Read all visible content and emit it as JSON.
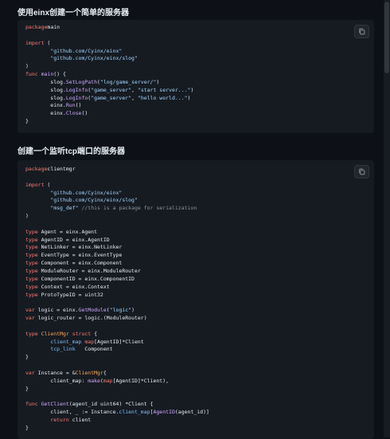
{
  "sections": [
    {
      "heading": "使用einx创建一个简单的服务器",
      "code": [
        [
          [
            "kw",
            "package"
          ],
          [
            "",
            "main"
          ]
        ],
        [],
        [
          [
            "kw",
            "import"
          ],
          [
            "",
            " ("
          ]
        ],
        [
          [
            "",
            " \t"
          ],
          [
            "str",
            "\"github.com/Cyinx/einx\""
          ]
        ],
        [
          [
            "",
            " \t"
          ],
          [
            "str",
            "\"github.com/Cyinx/einx/slog\""
          ]
        ],
        [
          [
            "",
            ")"
          ]
        ],
        [
          [
            "kw",
            "func"
          ],
          [
            "",
            " "
          ],
          [
            "fn",
            "main"
          ],
          [
            "",
            "() {"
          ]
        ],
        [
          [
            "",
            " \tslog."
          ],
          [
            "fn",
            "SetLogPath"
          ],
          [
            "",
            "("
          ],
          [
            "str",
            "\"log/game_server/\""
          ],
          [
            "",
            ")"
          ]
        ],
        [
          [
            "",
            " \tslog."
          ],
          [
            "fn",
            "LogInfo"
          ],
          [
            "",
            "("
          ],
          [
            "str",
            "\"game_server\""
          ],
          [
            "",
            ", "
          ],
          [
            "str",
            "\"start server...\""
          ],
          [
            "",
            ")"
          ]
        ],
        [
          [
            "",
            " \tslog."
          ],
          [
            "fn",
            "LogInfo"
          ],
          [
            "",
            "("
          ],
          [
            "str",
            "\"game_server\""
          ],
          [
            "",
            ", "
          ],
          [
            "str",
            "\"hello world...\""
          ],
          [
            "",
            ")"
          ]
        ],
        [
          [
            "",
            " \teinx."
          ],
          [
            "fn",
            "Run"
          ],
          [
            "",
            "()"
          ]
        ],
        [
          [
            "",
            " \teinx."
          ],
          [
            "fn",
            "Close"
          ],
          [
            "",
            "()"
          ]
        ],
        [
          [
            "",
            "}"
          ]
        ]
      ]
    },
    {
      "heading": "创建一个监听tcp端口的服务器",
      "code": [
        [
          [
            "kw",
            "package"
          ],
          [
            "",
            "clientmgr"
          ]
        ],
        [],
        [
          [
            "kw",
            "import"
          ],
          [
            "",
            " ("
          ]
        ],
        [
          [
            "",
            " \t"
          ],
          [
            "str",
            "\"github.com/Cyinx/einx\""
          ]
        ],
        [
          [
            "",
            " \t"
          ],
          [
            "str",
            "\"github.com/Cyinx/einx/slog\""
          ]
        ],
        [
          [
            "",
            " \t"
          ],
          [
            "str",
            "\"msg_def\""
          ],
          [
            "",
            " "
          ],
          [
            "cm",
            "//this is a package for serialization"
          ]
        ],
        [
          [
            "",
            ")"
          ]
        ],
        [],
        [
          [
            "kw",
            "type"
          ],
          [
            "",
            " Agent = einx.Agent"
          ]
        ],
        [
          [
            "kw",
            "type"
          ],
          [
            "",
            " AgentID = einx.AgentID"
          ]
        ],
        [
          [
            "kw",
            "type"
          ],
          [
            "",
            " NetLinker = einx.NetLinker"
          ]
        ],
        [
          [
            "kw",
            "type"
          ],
          [
            "",
            " EventType = einx.EventType"
          ]
        ],
        [
          [
            "kw",
            "type"
          ],
          [
            "",
            " Component = einx.Component"
          ]
        ],
        [
          [
            "kw",
            "type"
          ],
          [
            "",
            " ModuleRouter = einx.ModuleRouter"
          ]
        ],
        [
          [
            "kw",
            "type"
          ],
          [
            "",
            " ComponentID = einx.ComponentID"
          ]
        ],
        [
          [
            "kw",
            "type"
          ],
          [
            "",
            " Context = einx.Context"
          ]
        ],
        [
          [
            "kw",
            "type"
          ],
          [
            "",
            " ProtoTypeID = uint32"
          ]
        ],
        [],
        [
          [
            "kw",
            "var"
          ],
          [
            "",
            " logic = einx."
          ],
          [
            "fn",
            "GetModule"
          ],
          [
            "",
            "("
          ],
          [
            "str",
            "\"logic\""
          ],
          [
            "",
            ")"
          ]
        ],
        [
          [
            "kw",
            "var"
          ],
          [
            "",
            " logic_router = logic.(ModuleRouter)"
          ]
        ],
        [],
        [
          [
            "kw",
            "type"
          ],
          [
            "",
            " "
          ],
          [
            "ty",
            "ClientMgr"
          ],
          [
            "",
            " "
          ],
          [
            "kw",
            "struct"
          ],
          [
            "",
            " {"
          ]
        ],
        [
          [
            "",
            " \t"
          ],
          [
            "id",
            "client_map"
          ],
          [
            "",
            " "
          ],
          [
            "kw",
            "map"
          ],
          [
            "",
            "[AgentID]*Client"
          ]
        ],
        [
          [
            "",
            " \t"
          ],
          [
            "id",
            "tcp_link"
          ],
          [
            "",
            "   Component"
          ]
        ],
        [
          [
            "",
            "}"
          ]
        ],
        [],
        [
          [
            "kw",
            "var"
          ],
          [
            "",
            " Instance = &"
          ],
          [
            "ty",
            "ClientMgr"
          ],
          [
            "",
            "{"
          ]
        ],
        [
          [
            "",
            " \tclient_map: "
          ],
          [
            "fn",
            "make"
          ],
          [
            "",
            "("
          ],
          [
            "kw",
            "map"
          ],
          [
            "",
            "[AgentID]*Client),"
          ]
        ],
        [
          [
            "",
            "}"
          ]
        ],
        [],
        [
          [
            "kw",
            "func"
          ],
          [
            "",
            " "
          ],
          [
            "fn",
            "GetClient"
          ],
          [
            "",
            "(agent_id uint64) *Client {"
          ]
        ],
        [
          [
            "",
            " \tclient, _ := Instance."
          ],
          [
            "id",
            "client_map"
          ],
          [
            "",
            "["
          ],
          [
            "fn",
            "AgentID"
          ],
          [
            "",
            "(agent_id)]"
          ]
        ],
        [
          [
            "",
            " \t"
          ],
          [
            "kw",
            "return"
          ],
          [
            "",
            " client"
          ]
        ],
        [
          [
            "",
            "}"
          ]
        ]
      ]
    }
  ],
  "icons": {
    "copy": "copy-icon"
  }
}
